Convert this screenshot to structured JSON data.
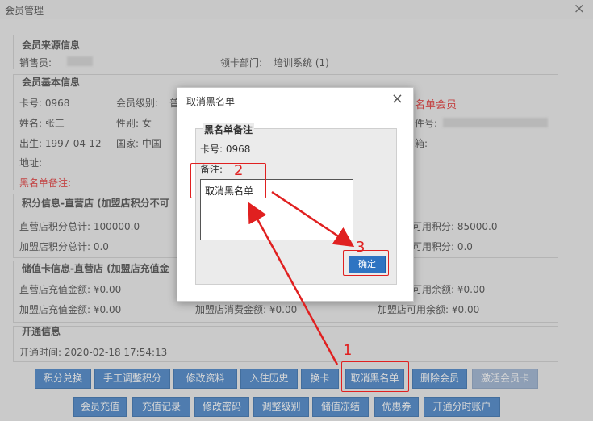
{
  "window": {
    "title": "会员管理",
    "close": "×"
  },
  "source": {
    "title": "会员来源信息",
    "salesperson_label": "销售员:",
    "card_dept_label": "领卡部门:",
    "card_dept_value": "培训系统 (1)"
  },
  "basic": {
    "title": "会员基本信息",
    "card_no": "卡号: 0968",
    "level_label": "会员级别:",
    "level_partial": "普",
    "status_partial": "名单会员",
    "name": "姓名: 张三",
    "gender": "性别: 女",
    "id_partial": "件号:",
    "birth": "出生: 1997-04-12",
    "country": "国家: 中国",
    "address": "地址:",
    "email_partial": "箱:",
    "blacklist_remark": "黑名单备注:"
  },
  "points": {
    "title": "积分信息-直营店 (加盟店积分不可",
    "direct_total": "直营店积分总计: 100000.0",
    "direct_available": "可用积分: 85000.0",
    "franchise_total": "加盟店积分总计: 0.0",
    "franchise_available": "可用积分: 0.0"
  },
  "stored": {
    "title": "储值卡信息-直营店 (加盟店充值金",
    "direct_recharge": "直营店充值金额: ¥0.00",
    "direct_balance": "可用余额: ¥0.00",
    "franchise_recharge": "加盟店充值金额: ¥0.00",
    "franchise_consume": "加盟店消费金额: ¥0.00",
    "franchise_balance": "加盟店可用余额: ¥0.00"
  },
  "open": {
    "title": "开通信息",
    "time": "开通时间: 2020-02-18 17:54:13"
  },
  "buttons_row1": [
    "积分兑换",
    "手工调整积分",
    "修改资料",
    "入住历史",
    "换卡",
    "取消黑名单",
    "删除会员",
    "激活会员卡"
  ],
  "buttons_row2": [
    "会员充值",
    "充值记录",
    "修改密码",
    "调整级别",
    "储值冻结",
    "优惠券",
    "开通分时账户"
  ],
  "dialog": {
    "title": "取消黑名单",
    "close": "×",
    "section_title": "黑名单备注",
    "card_no": "卡号: 0968",
    "remark_label": "备注:",
    "remark_value": "取消黑名单",
    "ok": "确定"
  },
  "annotations": {
    "step1": "1",
    "step2": "2",
    "step3": "3",
    "color": "#e02020"
  }
}
